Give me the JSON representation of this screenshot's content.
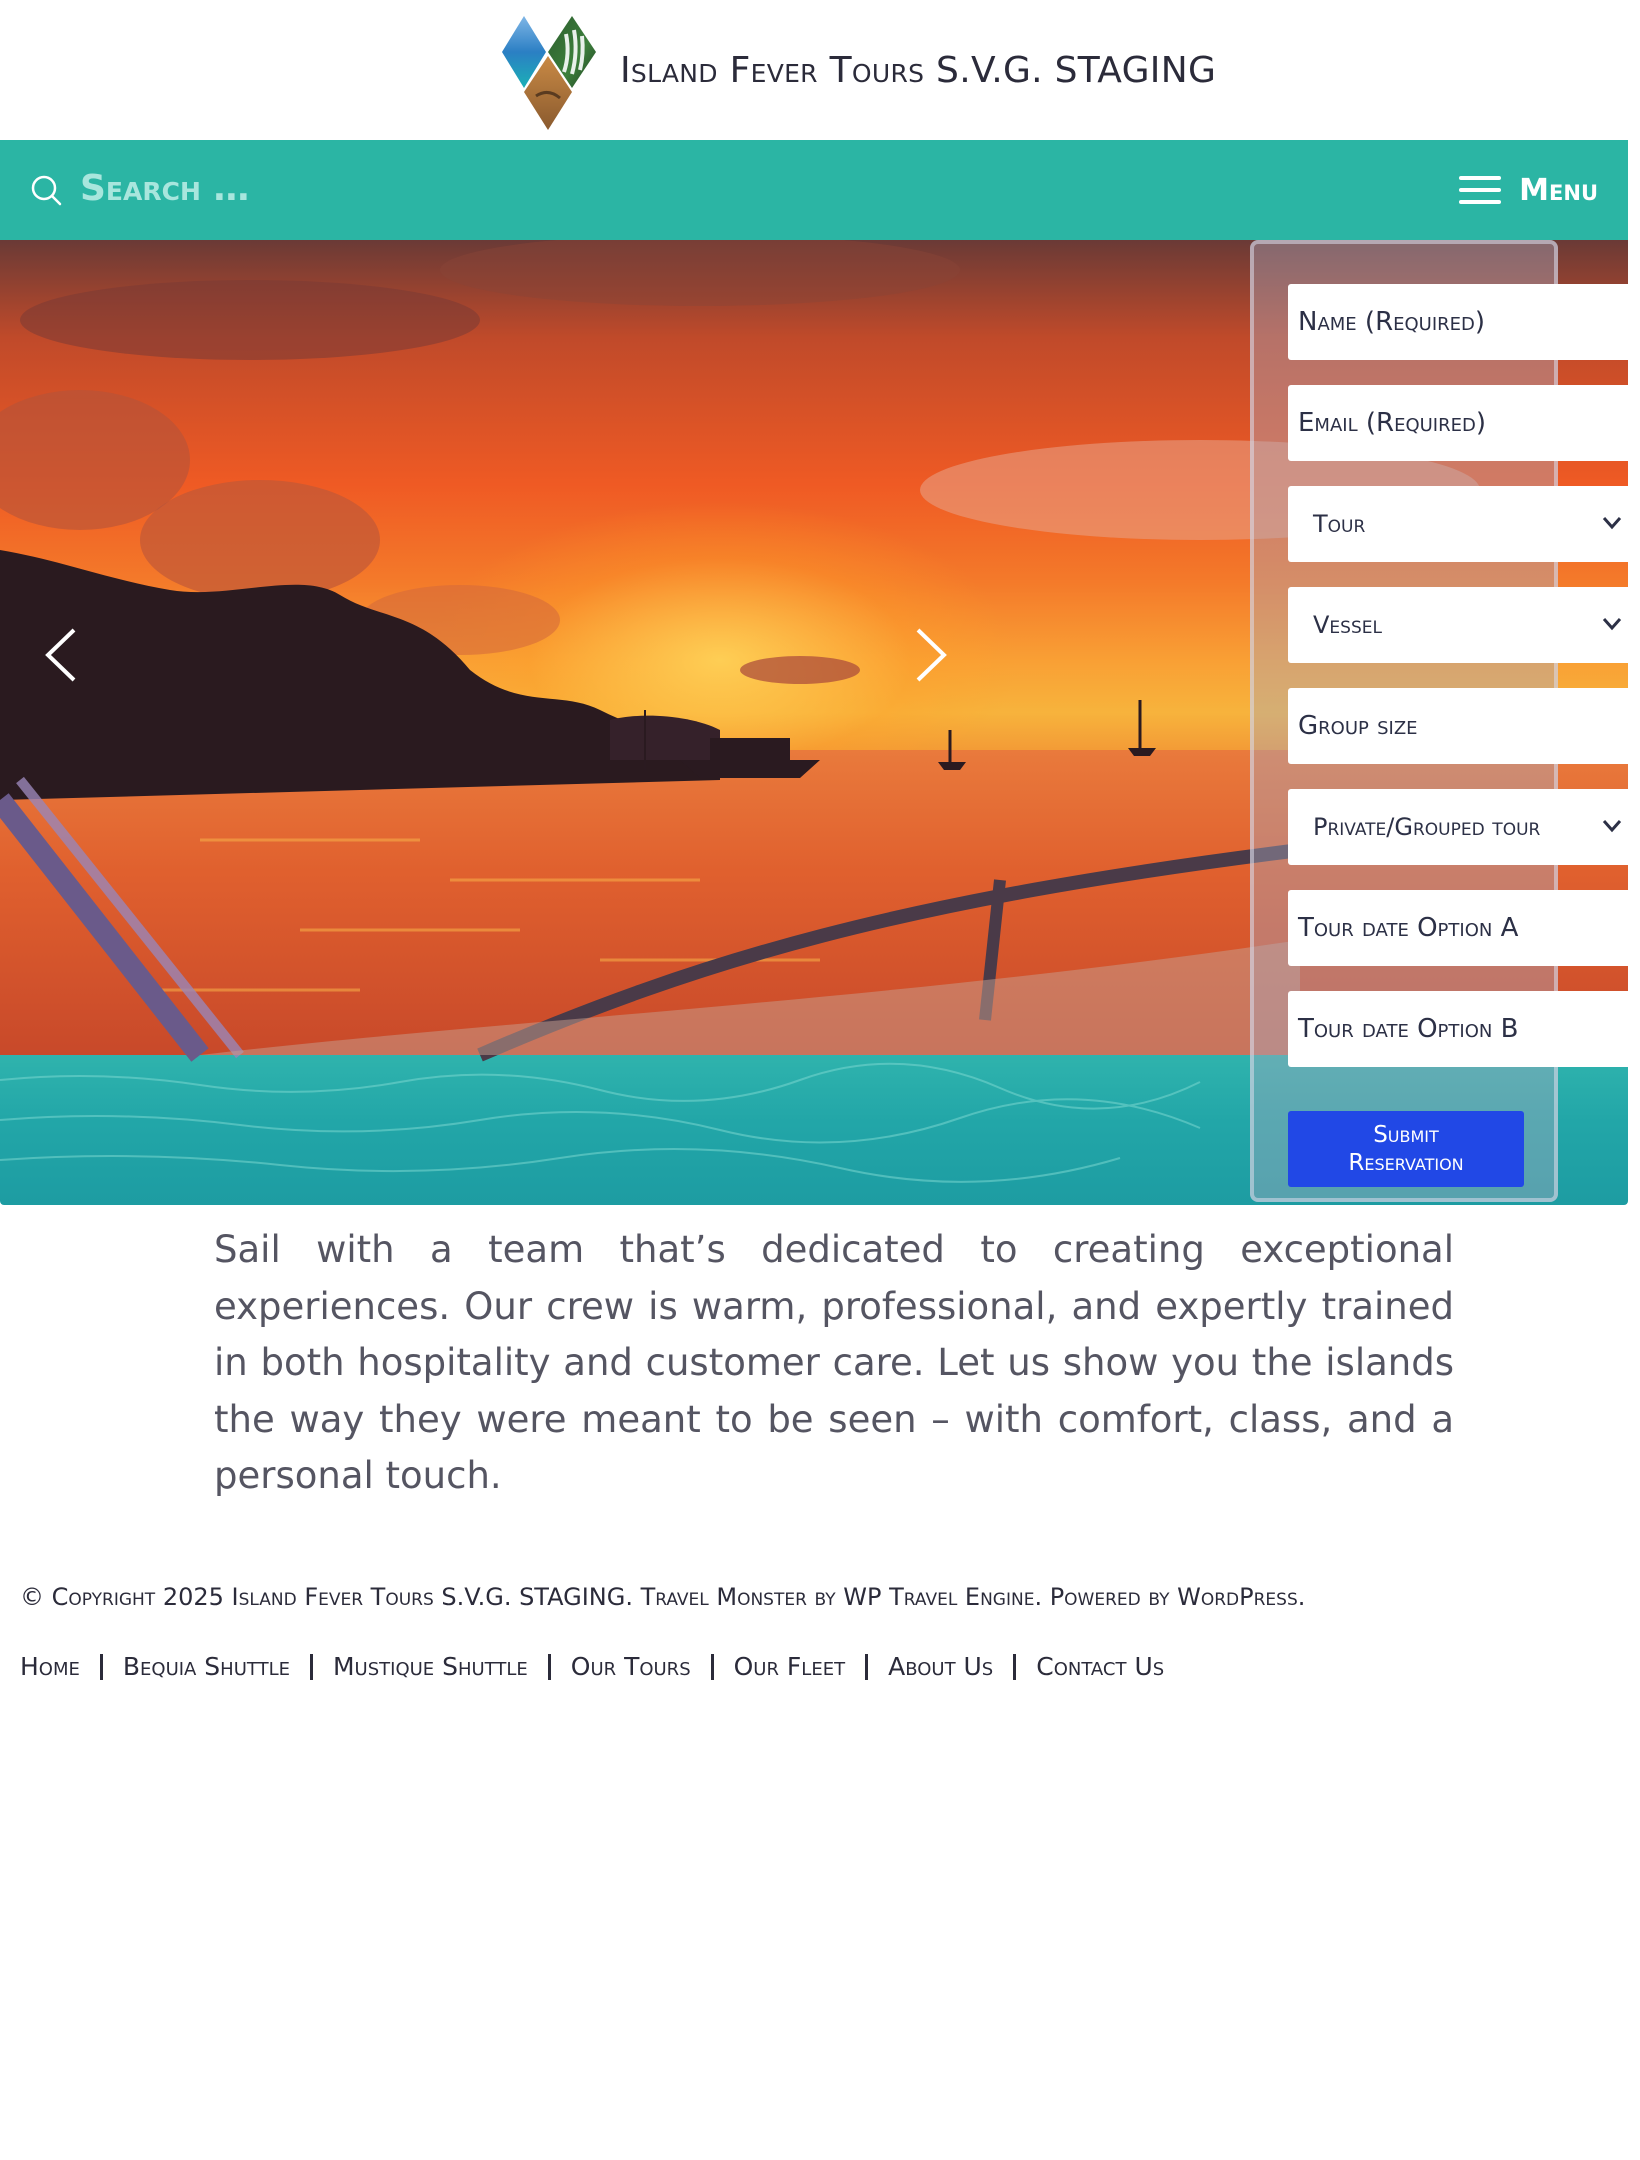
{
  "header": {
    "site_title": "Island Fever Tours S.V.G. STAGING"
  },
  "navbar": {
    "search_placeholder": "Search …",
    "menu_label": "Menu"
  },
  "colors": {
    "nav_bar": "#2bb5a4",
    "submit_button": "#2148e6"
  },
  "icons": [
    "search-icon",
    "hamburger-menu-icon",
    "chevron-left-icon",
    "chevron-right-icon",
    "chevron-down-icon"
  ],
  "reservation_form": {
    "name_placeholder": "Name (Required)",
    "email_placeholder": "Email (Required)",
    "tour_select": "Tour",
    "vessel_select": "Vessel",
    "group_size_placeholder": "Group size",
    "tour_type_select": "Private/Grouped tour",
    "date_a_placeholder": "Tour date Option A",
    "date_b_placeholder": "Tour date Option B",
    "submit_line1": "Submit",
    "submit_line2": "Reservation"
  },
  "main": {
    "intro_text": "Sail with a team that’s dedicated to creating exceptional experiences. Our crew is warm, professional, and expertly trained in both hospitality and customer care. Let us show you the islands the way they were meant to be seen – with comfort, class, and a personal touch."
  },
  "footer": {
    "copyright": "© Copyright 2025 Island Fever Tours S.V.G. STAGING. Travel Monster by WP Travel Engine. Powered by WordPress.",
    "links": [
      "Home",
      "Bequia Shuttle",
      "Mustique Shuttle",
      "Our Tours",
      "Our Fleet",
      "About Us",
      "Contact Us"
    ]
  }
}
